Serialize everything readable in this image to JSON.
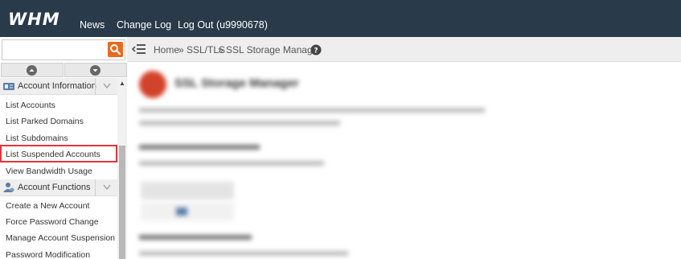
{
  "header": {
    "logo": "WHM",
    "nav": [
      {
        "label": "News"
      },
      {
        "label": "Change Log"
      },
      {
        "label": "Log Out (u9990678)"
      }
    ]
  },
  "search": {
    "value": "",
    "placeholder": ""
  },
  "breadcrumb": {
    "items": [
      "Home",
      "SSL/TLS",
      "SSL Storage Manager"
    ],
    "separator": "»"
  },
  "sidebar": {
    "categories": [
      {
        "label": "Account Information",
        "items": [
          {
            "label": "List Accounts"
          },
          {
            "label": "List Parked Domains"
          },
          {
            "label": "List Subdomains"
          },
          {
            "label": "List Suspended Accounts",
            "highlighted": true
          },
          {
            "label": "View Bandwidth Usage"
          }
        ]
      },
      {
        "label": "Account Functions",
        "items": [
          {
            "label": "Create a New Account"
          },
          {
            "label": "Force Password Change"
          },
          {
            "label": "Manage Account Suspension"
          },
          {
            "label": "Password Modification"
          }
        ]
      }
    ]
  },
  "main": {
    "title": "SSL Storage Manager",
    "blurred": true
  },
  "colors": {
    "topbar": "#293a4a",
    "search_button": "#e86a1f",
    "highlight_border": "#e4343a",
    "breadcrumb_bg": "#eeeeee"
  },
  "icons": {
    "search": "search-icon",
    "menu_toggle": "menu-collapse-icon",
    "help": "help-icon",
    "scroll_up": "arrow-up-icon",
    "scroll_down": "arrow-down-icon"
  }
}
